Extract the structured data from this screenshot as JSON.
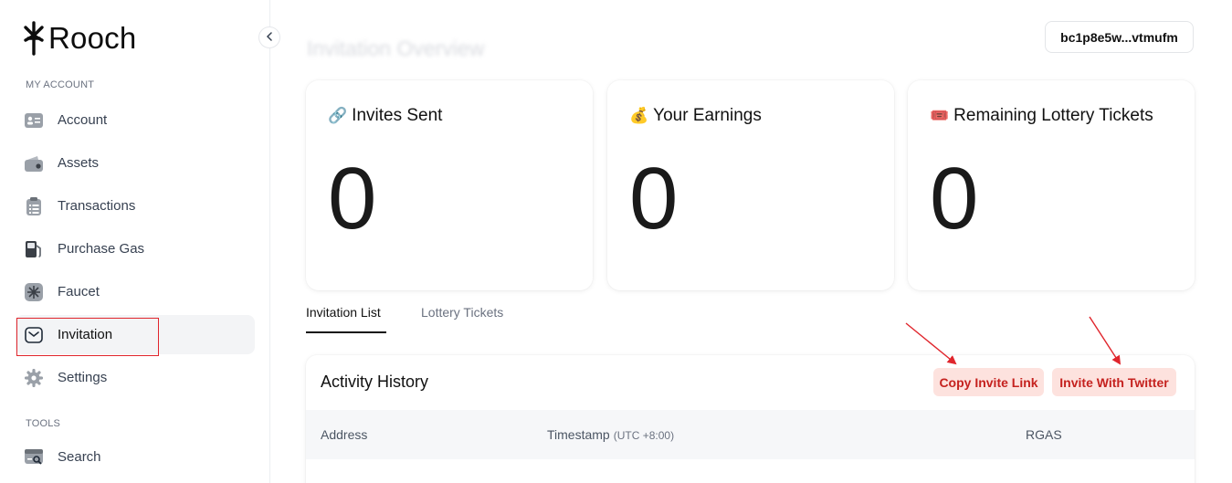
{
  "brand": {
    "name": "Rooch"
  },
  "sidebar": {
    "sections": {
      "account": "MY ACCOUNT",
      "tools": "TOOLS"
    },
    "items": [
      {
        "label": "Account",
        "icon": "account-card-icon"
      },
      {
        "label": "Assets",
        "icon": "wallet-icon"
      },
      {
        "label": "Transactions",
        "icon": "clipboard-icon"
      },
      {
        "label": "Purchase Gas",
        "icon": "gas-pump-icon"
      },
      {
        "label": "Faucet",
        "icon": "faucet-icon"
      },
      {
        "label": "Invitation",
        "icon": "envelope-icon",
        "active": true
      },
      {
        "label": "Settings",
        "icon": "gear-icon"
      }
    ],
    "tools_items": [
      {
        "label": "Search",
        "icon": "search-icon"
      }
    ]
  },
  "header": {
    "title": "Invitation Overview",
    "address": "bc1p8e5w...vtmufm"
  },
  "cards": [
    {
      "emoji": "🔗",
      "title": "Invites Sent",
      "value": "0"
    },
    {
      "emoji": "💰",
      "title": "Your Earnings",
      "value": "0"
    },
    {
      "emoji": "🎟️",
      "title": "Remaining Lottery Tickets",
      "value": "0"
    }
  ],
  "tabs": [
    {
      "label": "Invitation List",
      "active": true
    },
    {
      "label": "Lottery Tickets",
      "active": false
    }
  ],
  "activity": {
    "title": "Activity History",
    "copy_link_label": "Copy Invite Link",
    "twitter_label": "Invite With Twitter",
    "columns": {
      "address": "Address",
      "timestamp": "Timestamp",
      "timestamp_suffix": "(UTC +8:00)",
      "rgas": "RGAS"
    }
  },
  "colors": {
    "accent_red": "#c5221f",
    "pill_bg": "#fde2de",
    "highlight": "#e0252c"
  }
}
